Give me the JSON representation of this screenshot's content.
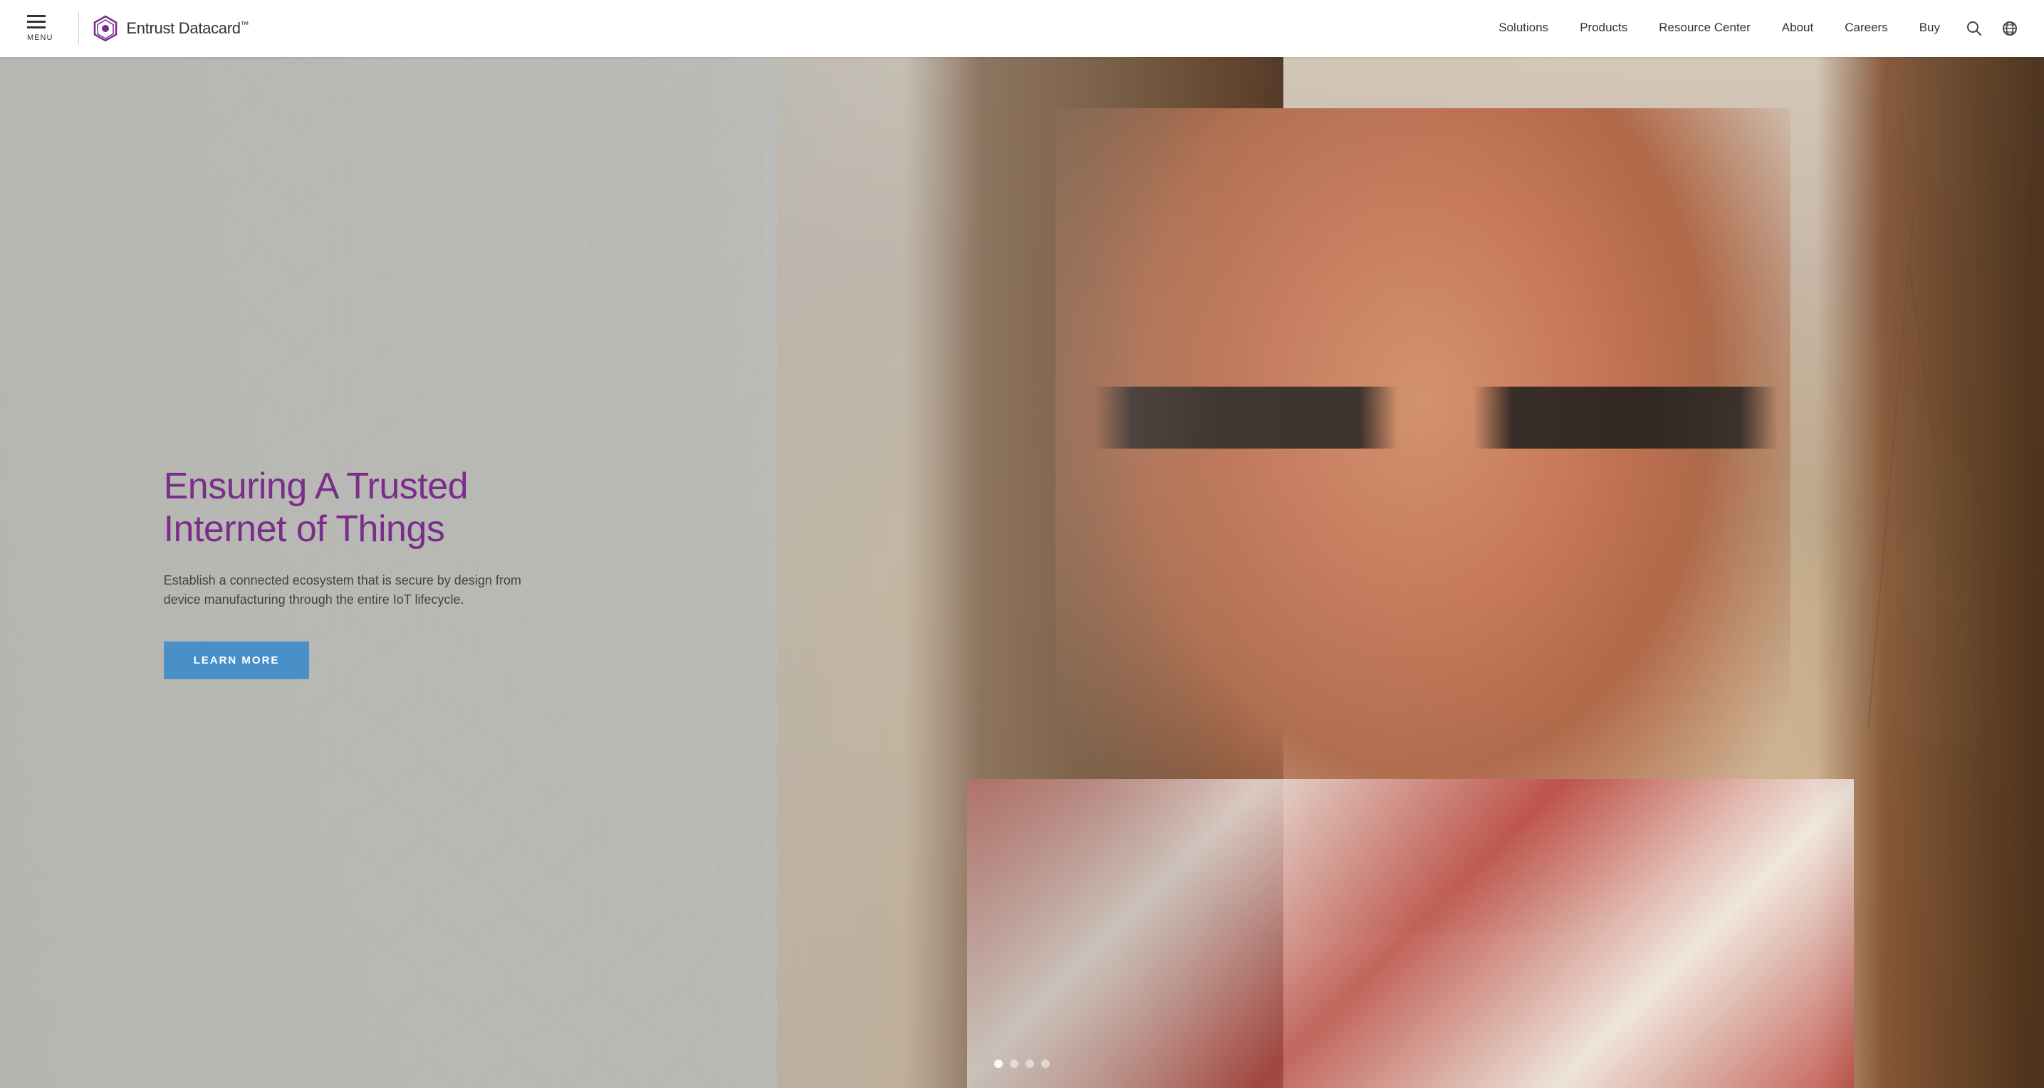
{
  "header": {
    "menu_label": "MENU",
    "logo_text": "Entrust Datacard",
    "logo_trademark": "™",
    "nav_items": [
      {
        "label": "Solutions",
        "id": "solutions"
      },
      {
        "label": "Products",
        "id": "products"
      },
      {
        "label": "Resource Center",
        "id": "resource-center"
      },
      {
        "label": "About",
        "id": "about"
      },
      {
        "label": "Careers",
        "id": "careers"
      },
      {
        "label": "Buy",
        "id": "buy"
      }
    ],
    "search_icon": "search",
    "globe_icon": "globe"
  },
  "hero": {
    "heading_line1": "Ensuring A Trusted",
    "heading_line2": "Internet of Things",
    "subtext": "Establish a connected ecosystem that is secure by design from device manufacturing through the entire IoT lifecycle.",
    "cta_label": "LEARN MORE",
    "dots": [
      {
        "active": true
      },
      {
        "active": false
      },
      {
        "active": false
      },
      {
        "active": false
      }
    ]
  },
  "colors": {
    "purple": "#7b2d8b",
    "blue_cta": "#4a90c8",
    "nav_text": "#333333",
    "hero_subtext": "#444444"
  }
}
